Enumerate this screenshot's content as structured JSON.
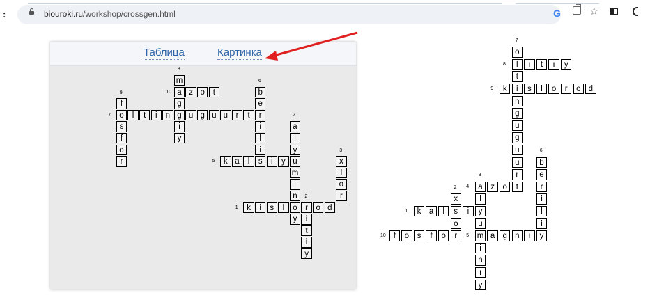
{
  "browser": {
    "url_host": "biouroki.ru",
    "url_path": "/workshop/crossgen.html",
    "icons": [
      "lock-icon",
      "google-icon",
      "share-icon",
      "star-icon",
      "side-panel-icon"
    ]
  },
  "tabs": {
    "table_label": "Таблица",
    "picture_label": "Картинка"
  },
  "annotation": {
    "arrow_color": "#e02020"
  },
  "colors": {
    "link": "#2d65a8",
    "panel_bg": "#eaeaea"
  },
  "crossword_left": {
    "words": [
      {
        "num": "1",
        "answer": "kislorod",
        "dir": "across",
        "row": 16,
        "col": 14
      },
      {
        "num": "2",
        "answer": "litiy",
        "dir": "down",
        "row": 16,
        "col": 19
      },
      {
        "num": "3",
        "answer": "xlor",
        "dir": "down",
        "row": 12,
        "col": 22
      },
      {
        "num": "4",
        "answer": "alyuminiy",
        "dir": "down",
        "row": 9,
        "col": 18
      },
      {
        "num": "5",
        "answer": "kalsiy",
        "dir": "across",
        "row": 12,
        "col": 12
      },
      {
        "num": "6",
        "answer": "beriliy",
        "dir": "down",
        "row": 6,
        "col": 15
      },
      {
        "num": "7",
        "answer": "oltinguguurt",
        "dir": "across",
        "row": 8,
        "col": 3
      },
      {
        "num": "8",
        "answer": "magniy",
        "dir": "down",
        "row": 5,
        "col": 8
      },
      {
        "num": "9",
        "answer": "fosfor",
        "dir": "down",
        "row": 7,
        "col": 3
      },
      {
        "num": "10",
        "answer": "azot",
        "dir": "across",
        "row": 6,
        "col": 8
      }
    ]
  },
  "crossword_right": {
    "words": [
      {
        "num": "1",
        "answer": "kalsiy",
        "dir": "across",
        "row": 15,
        "col": 3
      },
      {
        "num": "2",
        "answer": "xlor",
        "dir": "down",
        "row": 14,
        "col": 6
      },
      {
        "num": "3",
        "answer": "alyuminiy",
        "dir": "down",
        "row": 13,
        "col": 8
      },
      {
        "num": "4",
        "answer": "azot",
        "dir": "across",
        "row": 13,
        "col": 8
      },
      {
        "num": "5",
        "answer": "magniy",
        "dir": "across",
        "row": 17,
        "col": 8
      },
      {
        "num": "6",
        "answer": "beriliy",
        "dir": "down",
        "row": 11,
        "col": 13
      },
      {
        "num": "7",
        "answer": "oltinguguurt",
        "dir": "down",
        "row": 2,
        "col": 11
      },
      {
        "num": "8",
        "answer": "litiy",
        "dir": "across",
        "row": 3,
        "col": 11
      },
      {
        "num": "9",
        "answer": "kislorod",
        "dir": "across",
        "row": 5,
        "col": 10
      },
      {
        "num": "10",
        "answer": "fosfor",
        "dir": "across",
        "row": 17,
        "col": 1
      }
    ]
  }
}
